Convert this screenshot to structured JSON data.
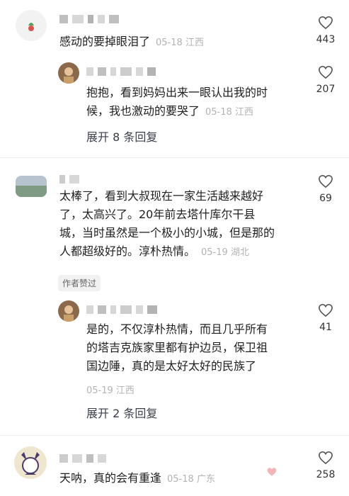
{
  "comments": [
    {
      "text": "感动的要掉眼泪了",
      "date": "05-18",
      "location": "江西",
      "likes": "443",
      "reply": {
        "text_line1": "抱抱，看到妈妈出来一眼认出我的时",
        "text_line2": "候，我也激动的要哭了",
        "date": "05-18",
        "location": "江西",
        "likes": "207"
      },
      "expand_label": "展开 8 条回复"
    },
    {
      "text_line1": "太棒了，看到大叔现在一家生活越来越好",
      "text_line2": "了，太高兴了。20年前去塔什库尔干县",
      "text_line3": "城，当时虽然是一个极小的小城，但是那的",
      "text_line4": "人都超级好的。淳朴热情。",
      "date": "05-19",
      "location": "湖北",
      "likes": "69",
      "badge": "作者赞过",
      "reply": {
        "text_line1": "是的，不仅淳朴热情，而且几乎所有",
        "text_line2": "的塔吉克族家里都有护边员，保卫祖",
        "text_line3": "国边陲，真的是太好太好的民族了",
        "date": "05-19",
        "location": "江西",
        "likes": "41"
      },
      "expand_label": "展开 2 条回复"
    },
    {
      "text": "天呐，真的会有重逢",
      "date": "05-18",
      "location": "广东",
      "likes": "258"
    }
  ],
  "icons": {
    "like": "heart-outline-icon"
  },
  "colors": {
    "meta": "#b3b3b3",
    "text": "#1f1f1f"
  }
}
